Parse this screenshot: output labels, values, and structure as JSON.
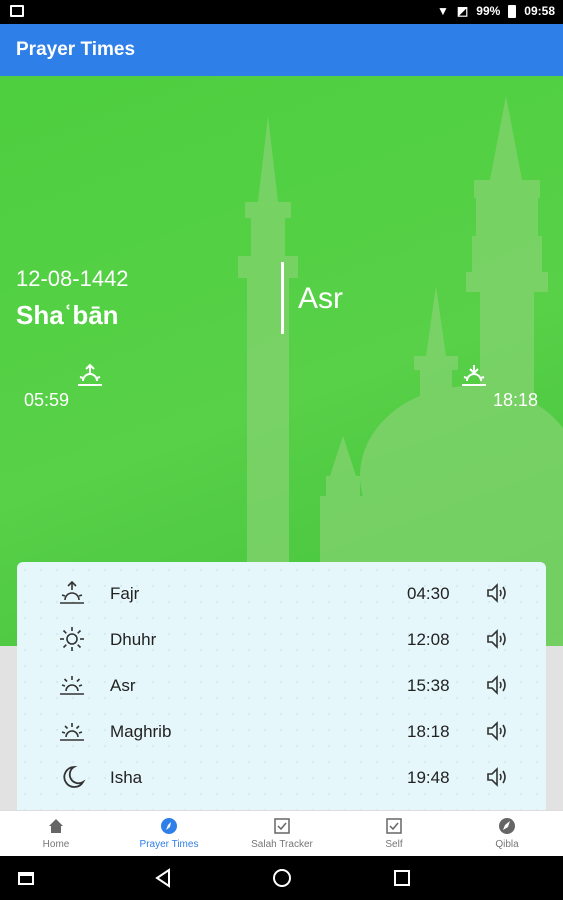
{
  "status_bar": {
    "battery": "99%",
    "time": "09:58"
  },
  "app_bar": {
    "title": "Prayer Times"
  },
  "hero": {
    "hijri_date": "12-08-1442",
    "hijri_month": "Shaʿbān",
    "current_prayer": "Asr",
    "sunrise_time": "05:59",
    "sunset_time": "18:18"
  },
  "prayers": [
    {
      "name": "Fajr",
      "time": "04:30",
      "icon": "sunrise-icon"
    },
    {
      "name": "Dhuhr",
      "time": "12:08",
      "icon": "sun-icon"
    },
    {
      "name": "Asr",
      "time": "15:38",
      "icon": "afternoon-sun-icon"
    },
    {
      "name": "Maghrib",
      "time": "18:18",
      "icon": "sunset-icon"
    },
    {
      "name": "Isha",
      "time": "19:48",
      "icon": "moon-icon"
    }
  ],
  "bottom_nav": [
    {
      "label": "Home",
      "icon": "home-icon"
    },
    {
      "label": "Prayer Times",
      "icon": "compass-icon",
      "active": true
    },
    {
      "label": "Salah Tracker",
      "icon": "checkbox-icon"
    },
    {
      "label": "Self",
      "icon": "checkbox-icon"
    },
    {
      "label": "Qibla",
      "icon": "compass-icon"
    }
  ],
  "colors": {
    "app_bar": "#2f7fe8",
    "hero_green": "#4dcf3f",
    "card_bg": "#e6f7fb",
    "active_nav": "#2f7fe8"
  }
}
